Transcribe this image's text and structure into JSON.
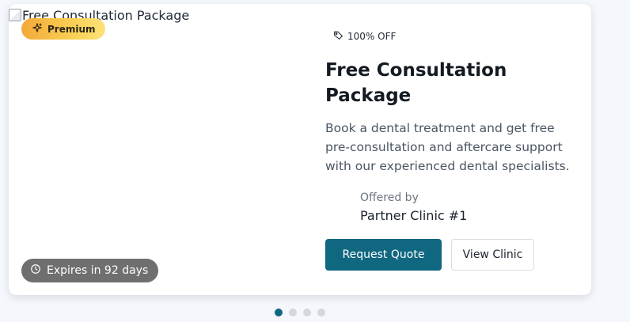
{
  "card": {
    "image_alt": "Free Consultation Package",
    "badge_premium": "Premium",
    "expiry": "Expires in 92 days",
    "discount": "100% OFF",
    "title": "Free Consultation Package",
    "description": "Book a dental treatment and get free pre-consultation and aftercare support with our experienced dental specialists.",
    "offered_by_label": "Offered by",
    "clinic_name": "Partner Clinic #1",
    "primary_button": "Request Quote",
    "secondary_button": "View Clinic"
  },
  "carousel": {
    "slides": 4,
    "active_index": 0
  },
  "colors": {
    "primary": "#0f6780",
    "premium_start": "#f3a83a",
    "premium_end": "#fde27a"
  }
}
